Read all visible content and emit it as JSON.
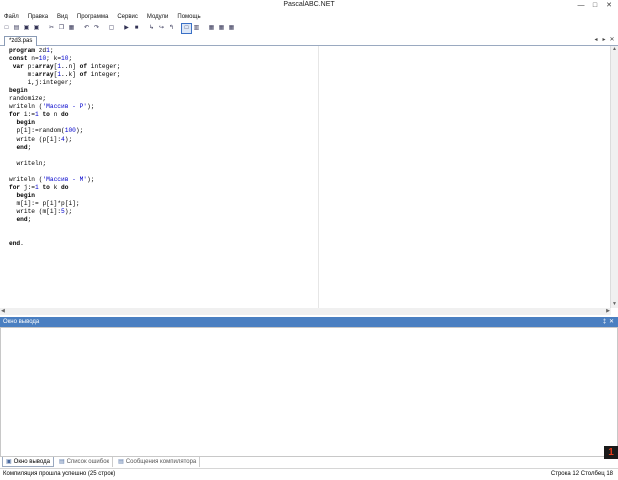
{
  "window": {
    "title": "PascalABC.NET",
    "controls": [
      "—",
      "□",
      "✕"
    ]
  },
  "menu": [
    "Файл",
    "Правка",
    "Вид",
    "Программа",
    "Сервис",
    "Модули",
    "Помощь"
  ],
  "toolbar": [
    {
      "name": "new-file-icon",
      "glyph": "□"
    },
    {
      "name": "open-file-icon",
      "glyph": "▤"
    },
    {
      "name": "save-icon",
      "glyph": "▣"
    },
    {
      "name": "save-all-icon",
      "glyph": "▣"
    },
    {
      "name": "separator",
      "glyph": ""
    },
    {
      "name": "cut-icon",
      "glyph": "✂"
    },
    {
      "name": "copy-icon",
      "glyph": "❐"
    },
    {
      "name": "paste-icon",
      "glyph": "▦"
    },
    {
      "name": "separator",
      "glyph": ""
    },
    {
      "name": "undo-icon",
      "glyph": "↶"
    },
    {
      "name": "redo-icon",
      "glyph": "↷"
    },
    {
      "name": "separator",
      "glyph": ""
    },
    {
      "name": "compile-icon",
      "glyph": "▢"
    },
    {
      "name": "separator",
      "glyph": ""
    },
    {
      "name": "run-icon",
      "glyph": "▶"
    },
    {
      "name": "stop-icon",
      "glyph": "■"
    },
    {
      "name": "separator",
      "glyph": ""
    },
    {
      "name": "step-into-icon",
      "glyph": "↳"
    },
    {
      "name": "step-over-icon",
      "glyph": "↪"
    },
    {
      "name": "step-out-icon",
      "glyph": "↰"
    },
    {
      "name": "separator",
      "glyph": ""
    },
    {
      "name": "output-window-icon",
      "glyph": "□",
      "active": true
    },
    {
      "name": "form-designer-icon",
      "glyph": "▥"
    },
    {
      "name": "separator",
      "glyph": ""
    },
    {
      "name": "format-code-icon",
      "glyph": "▦"
    },
    {
      "name": "options-icon",
      "glyph": "▦"
    },
    {
      "name": "help-icon",
      "glyph": "▦"
    }
  ],
  "editor_tab": {
    "label": "zd3.pas",
    "modified_mark": "*"
  },
  "tab_controls": [
    "◂",
    "▸",
    "✕"
  ],
  "code_lines": [
    "program zd1;",
    "const n=10; k=10;",
    " var p:array[1..n] of integer;",
    "     m:array[1..k] of integer;",
    "     i,j:integer;",
    "begin",
    "randomize;",
    "writeln ('Массив - P');",
    "for i:=1 to n do",
    "  begin",
    "  p[i]:=random(100);",
    "  write (p[i]:4);",
    "  end;",
    "",
    "  writeln;",
    "",
    "writeln ('Массив - M');",
    "for j:=1 to k do",
    "  begin",
    "  m[i]:= p[i]*p[i];",
    "  write (m[i]:5);",
    "  end;",
    "",
    "",
    "end."
  ],
  "output_panel": {
    "title": "Окно вывода",
    "controls": [
      "‡",
      "✕"
    ],
    "content": ""
  },
  "bottom_tabs": [
    {
      "label": "Окно вывода",
      "active": true
    },
    {
      "label": "Список ошибок",
      "active": false
    },
    {
      "label": "Сообщения компилятора",
      "active": false
    }
  ],
  "status": {
    "message": "Компиляция прошла успешно (25 строк)",
    "row_label": "Строка",
    "row_value": "12",
    "col_label": "Столбец",
    "col_value": "18"
  },
  "badge": "1",
  "colors": {
    "panel_header": "#4a7fc1",
    "badge_text": "#e53a1a",
    "number_literal": "#0000cc"
  }
}
